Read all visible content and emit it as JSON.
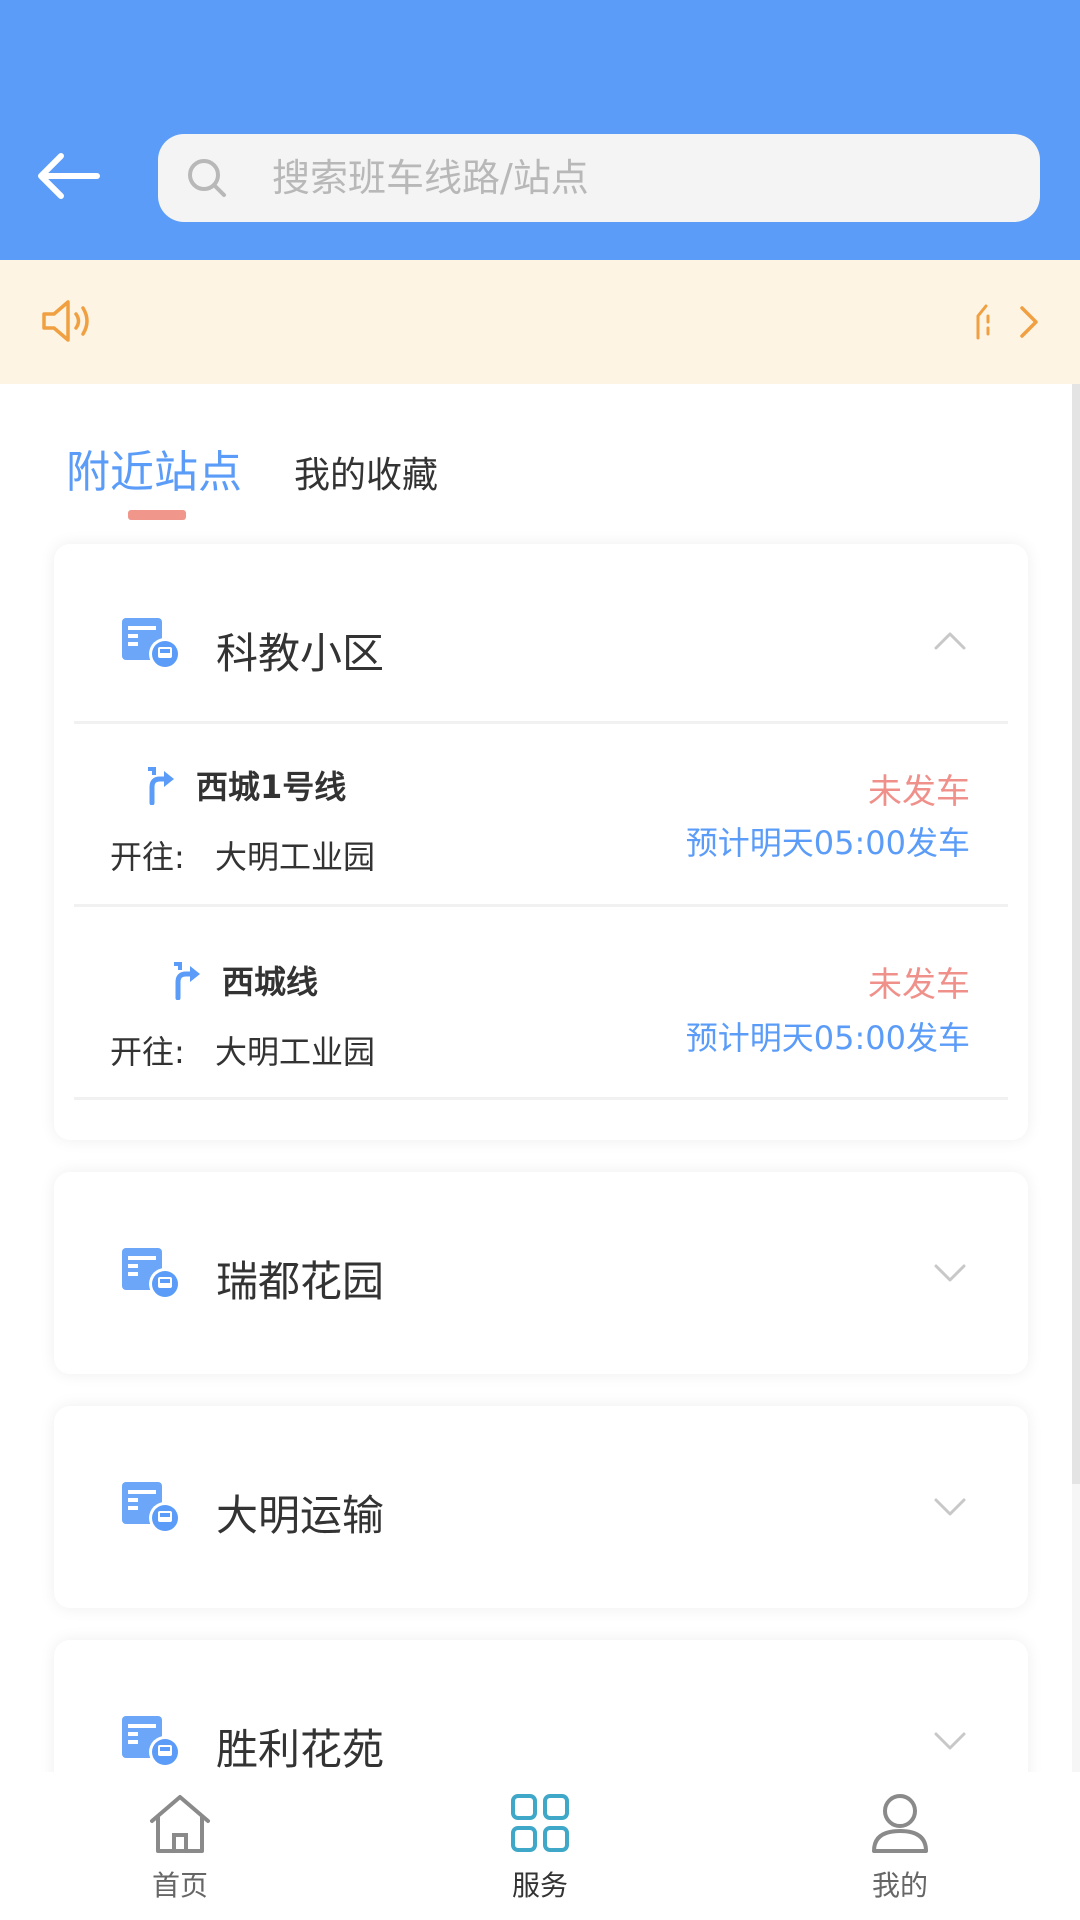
{
  "search": {
    "placeholder": "搜索班车线路/站点"
  },
  "tabs": {
    "nearby": "附近站点",
    "favorites": "我的收藏"
  },
  "stations": [
    {
      "name": "科教小区",
      "expanded": true,
      "routes": [
        {
          "name": "西城1号线",
          "dest_prefix": "开往:",
          "dest": "大明工业园",
          "status": "未发车",
          "schedule": "预计明天05:00发车"
        },
        {
          "name": "西城线",
          "dest_prefix": "开往:",
          "dest": "大明工业园",
          "status": "未发车",
          "schedule": "预计明天05:00发车"
        }
      ]
    },
    {
      "name": "瑞都花园",
      "expanded": false
    },
    {
      "name": "大明运输",
      "expanded": false
    },
    {
      "name": "胜利花苑",
      "expanded": false
    }
  ],
  "bottom_nav": [
    {
      "label": "首页",
      "icon": "home-icon"
    },
    {
      "label": "服务",
      "icon": "grid-icon",
      "active": true
    },
    {
      "label": "我的",
      "icon": "user-icon"
    }
  ],
  "colors": {
    "header": "#5b9cf8",
    "accent_blue": "#5b9cf8",
    "status_red": "#f0908a",
    "notice_bg": "#fdf4e4",
    "notice_icon": "#f0a040"
  }
}
